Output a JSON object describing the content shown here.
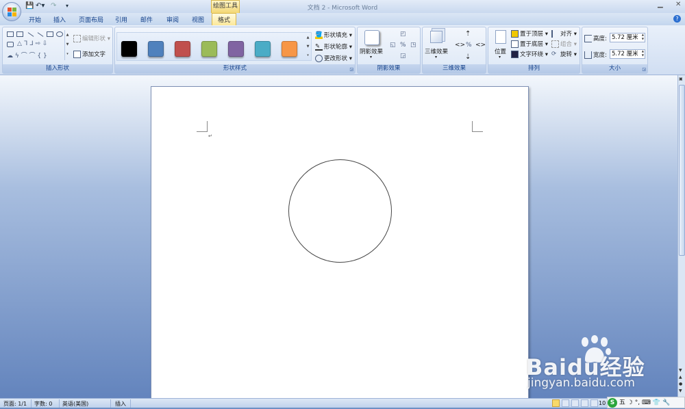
{
  "window": {
    "title": "文档 2 - Microsoft Word",
    "context_tool": "绘图工具"
  },
  "tabs": [
    {
      "label": "开始"
    },
    {
      "label": "插入"
    },
    {
      "label": "页面布局"
    },
    {
      "label": "引用"
    },
    {
      "label": "邮件"
    },
    {
      "label": "审阅"
    },
    {
      "label": "视图"
    },
    {
      "label": "格式",
      "active": true
    }
  ],
  "ribbon": {
    "insert_shapes": {
      "label": "插入形状",
      "edit_shape": "编辑形状",
      "add_text": "添加文字"
    },
    "shape_styles": {
      "label": "形状样式",
      "swatches": [
        "#000000",
        "#4f81bd",
        "#c0504d",
        "#9bbb59",
        "#8064a2",
        "#4bacc6",
        "#f79646"
      ],
      "fill": "形状填充",
      "outline": "形状轮廓",
      "change": "更改形状"
    },
    "shadow": {
      "label": "阴影效果",
      "button": "阴影效果"
    },
    "threed": {
      "label": "三维效果",
      "button": "三维效果"
    },
    "arrange": {
      "label": "排列",
      "position": "位置",
      "bring_front": "置于顶层",
      "send_back": "置于底层",
      "wrap_text": "文字环绕",
      "align": "对齐",
      "group": "组合",
      "rotate": "旋转"
    },
    "size": {
      "label": "大小",
      "height_label": "高度:",
      "height_value": "5.72 厘米",
      "width_label": "宽度:",
      "width_value": "5.72 厘米"
    }
  },
  "status": {
    "page": "页面: 1/1",
    "words": "字数: 0",
    "language": "英语(美国)",
    "mode": "插入",
    "zoom": "10"
  },
  "ime": {
    "label": "五"
  },
  "watermark": {
    "brand": "Baidu经验",
    "url": "jingyan.baidu.com"
  }
}
